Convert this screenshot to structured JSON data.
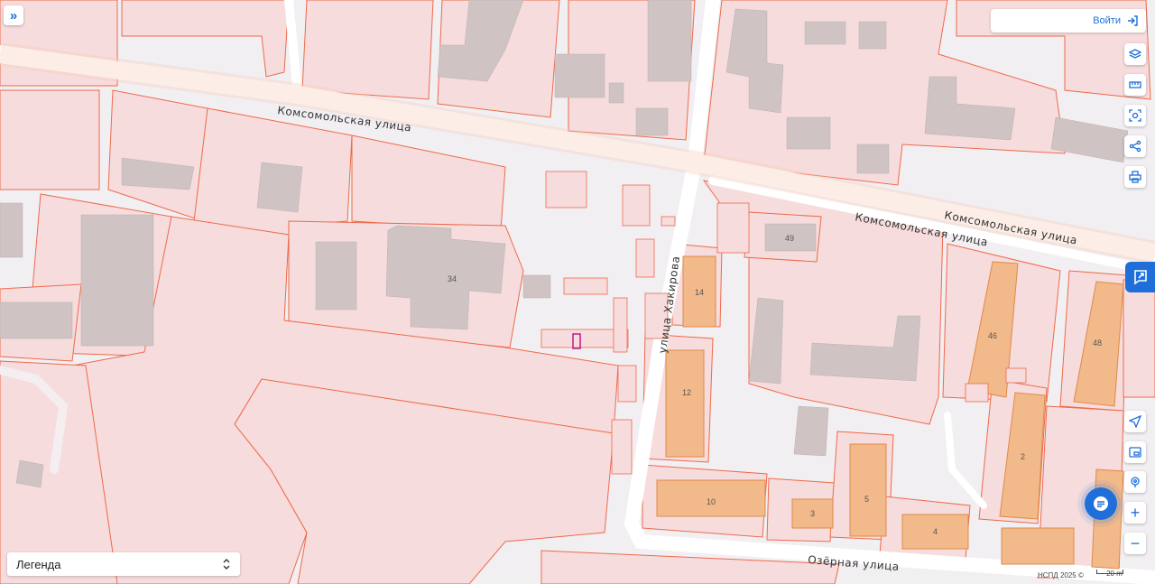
{
  "toolbar": {
    "expand_icon": "double-chevron-right-icon",
    "login_label": "Войти",
    "login_icon": "login-arrow-icon",
    "tools": [
      "layers-icon",
      "ruler-icon",
      "area-select-icon",
      "share-icon",
      "print-icon"
    ],
    "nav_tools": [
      "locate-arrow-icon",
      "minimap-icon",
      "geolocation-icon"
    ],
    "zoom_in": "+",
    "zoom_out": "−"
  },
  "legend": {
    "label": "Легенда",
    "icon": "chevron-up-down-icon"
  },
  "map": {
    "streets": [
      "Комсомольская улица",
      "Комсомольская улица",
      "улица Хакирова",
      "Озёрная улица"
    ],
    "building_numbers": [
      "34",
      "49",
      "14",
      "12",
      "46",
      "48",
      "2",
      "10",
      "3",
      "5",
      "4"
    ],
    "colors": {
      "parcel_fill": "#f6dcdc",
      "parcel_stroke": "#ef6a4a",
      "building_grey": "#cfc3c3",
      "building_orange": "#f2b98a",
      "road": "#ffffff",
      "highlight": "#c0198c"
    }
  },
  "attribution": {
    "text": "НСПД 2025 ©",
    "scale": "20 m"
  },
  "side_panel_icon": "cadastral-tab-icon",
  "chat_icon": "chat-icon"
}
